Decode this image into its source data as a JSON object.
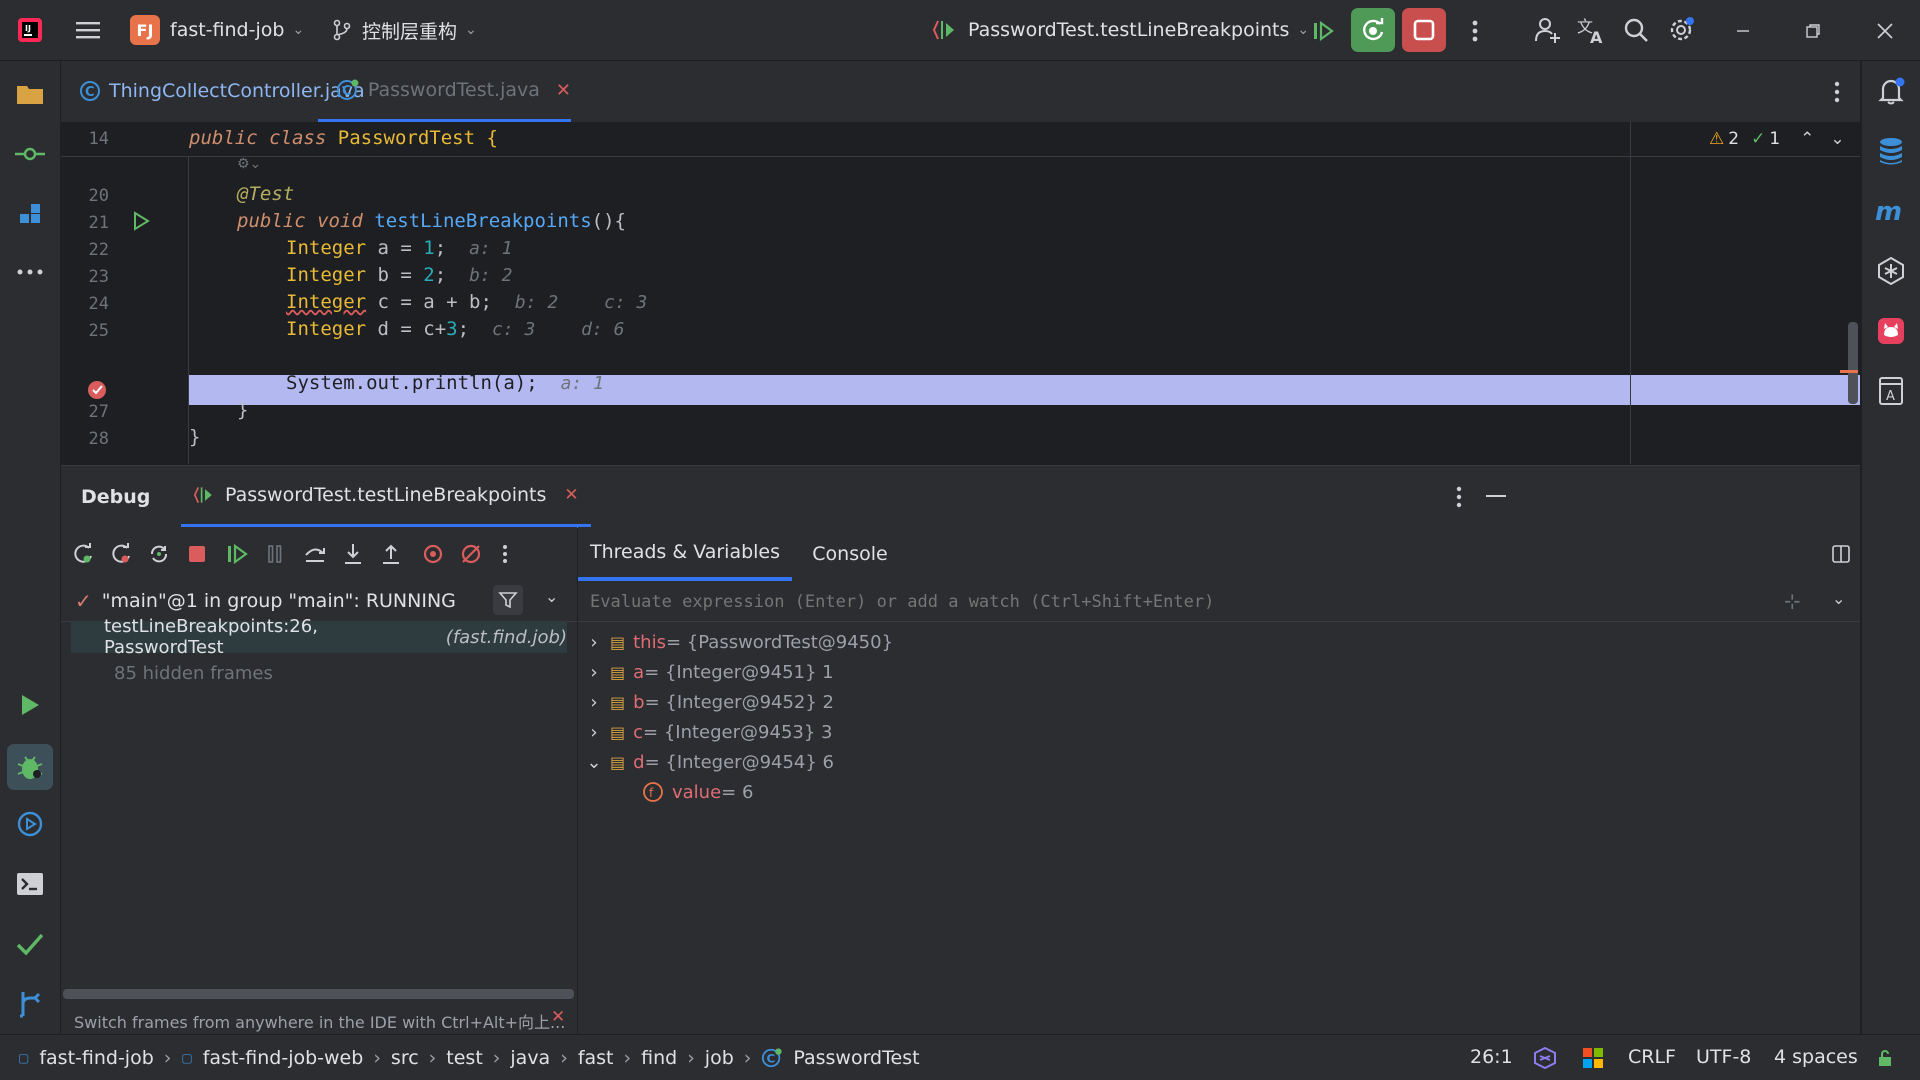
{
  "titlebar": {
    "project_initials": "FJ",
    "project_name": "fast-find-job",
    "vcs_branch": "控制层重构",
    "run_config": "PasswordTest.testLineBreakpoints"
  },
  "tabs": [
    {
      "label": "ThingCollectController.java"
    },
    {
      "label": "PasswordTest.java"
    }
  ],
  "editor": {
    "inspections": {
      "warnings": "2",
      "ok": "1"
    },
    "lines": [
      {
        "num": "14"
      },
      {
        "num": "20"
      },
      {
        "num": "21"
      },
      {
        "num": "22"
      },
      {
        "num": "23"
      },
      {
        "num": "24"
      },
      {
        "num": "25"
      },
      {
        "num": "27"
      },
      {
        "num": "28"
      }
    ],
    "code": {
      "l14_public": "public",
      "l14_class": "class",
      "l14_name": "PasswordTest {",
      "l20": "@Test",
      "l21_public": "public",
      "l21_void": "void",
      "l21_fn": "testLineBreakpoints",
      "l21_rest": "(){",
      "l22_type": "Integer",
      "l22_rest": " a = ",
      "l22_num": "1",
      "l22_end": ";",
      "l22_hint": "a: 1",
      "l23_type": "Integer",
      "l23_rest": " b = ",
      "l23_num": "2",
      "l23_end": ";",
      "l23_hint": "b: 2",
      "l24_type": "Integer",
      "l24_rest": " c = a + b;",
      "l24_hint1": "b: 2",
      "l24_hint2": "c: 3",
      "l25_type": "Integer",
      "l25_rest": " d = c+",
      "l25_num": "3",
      "l25_end": ";",
      "l25_hint1": "c: 3",
      "l25_hint2": "d: 6",
      "l26": "System.out.println(a);",
      "l26_hint": "a: 1",
      "l27": "}",
      "l28": "}"
    }
  },
  "debug": {
    "title": "Debug",
    "session_tab": "PasswordTest.testLineBreakpoints",
    "thread": "\"main\"@1 in group \"main\": RUNNING",
    "frame_main": "testLineBreakpoints:26, PasswordTest",
    "frame_pkg": "(fast.find.job)",
    "hidden_frames": "85 hidden frames",
    "hint_text": "Switch frames from anywhere in the IDE with Ctrl+Alt+向上...",
    "tab_threads": "Threads & Variables",
    "tab_console": "Console",
    "eval_placeholder": "Evaluate expression (Enter) or add a watch (Ctrl+Shift+Enter)",
    "variables": [
      {
        "name": "this",
        "value": " = {PasswordTest@9450}"
      },
      {
        "name": "a",
        "value": " = {Integer@9451} 1"
      },
      {
        "name": "b",
        "value": " = {Integer@9452} 2"
      },
      {
        "name": "c",
        "value": " = {Integer@9453} 3"
      },
      {
        "name": "d",
        "value": " = {Integer@9454} 6"
      }
    ],
    "child": {
      "name": "value",
      "value": " = 6"
    }
  },
  "statusbar": {
    "crumbs": [
      "fast-find-job",
      "fast-find-job-web",
      "src",
      "test",
      "java",
      "fast",
      "find",
      "job",
      "PasswordTest"
    ],
    "position": "26:1",
    "line_sep": "CRLF",
    "encoding": "UTF-8",
    "indent": "4 spaces"
  },
  "colors": {
    "accent": "#3574f0",
    "highlight_line": "#b4b8f0",
    "run_green": "#5fb865",
    "stop_red": "#db5c5c"
  }
}
